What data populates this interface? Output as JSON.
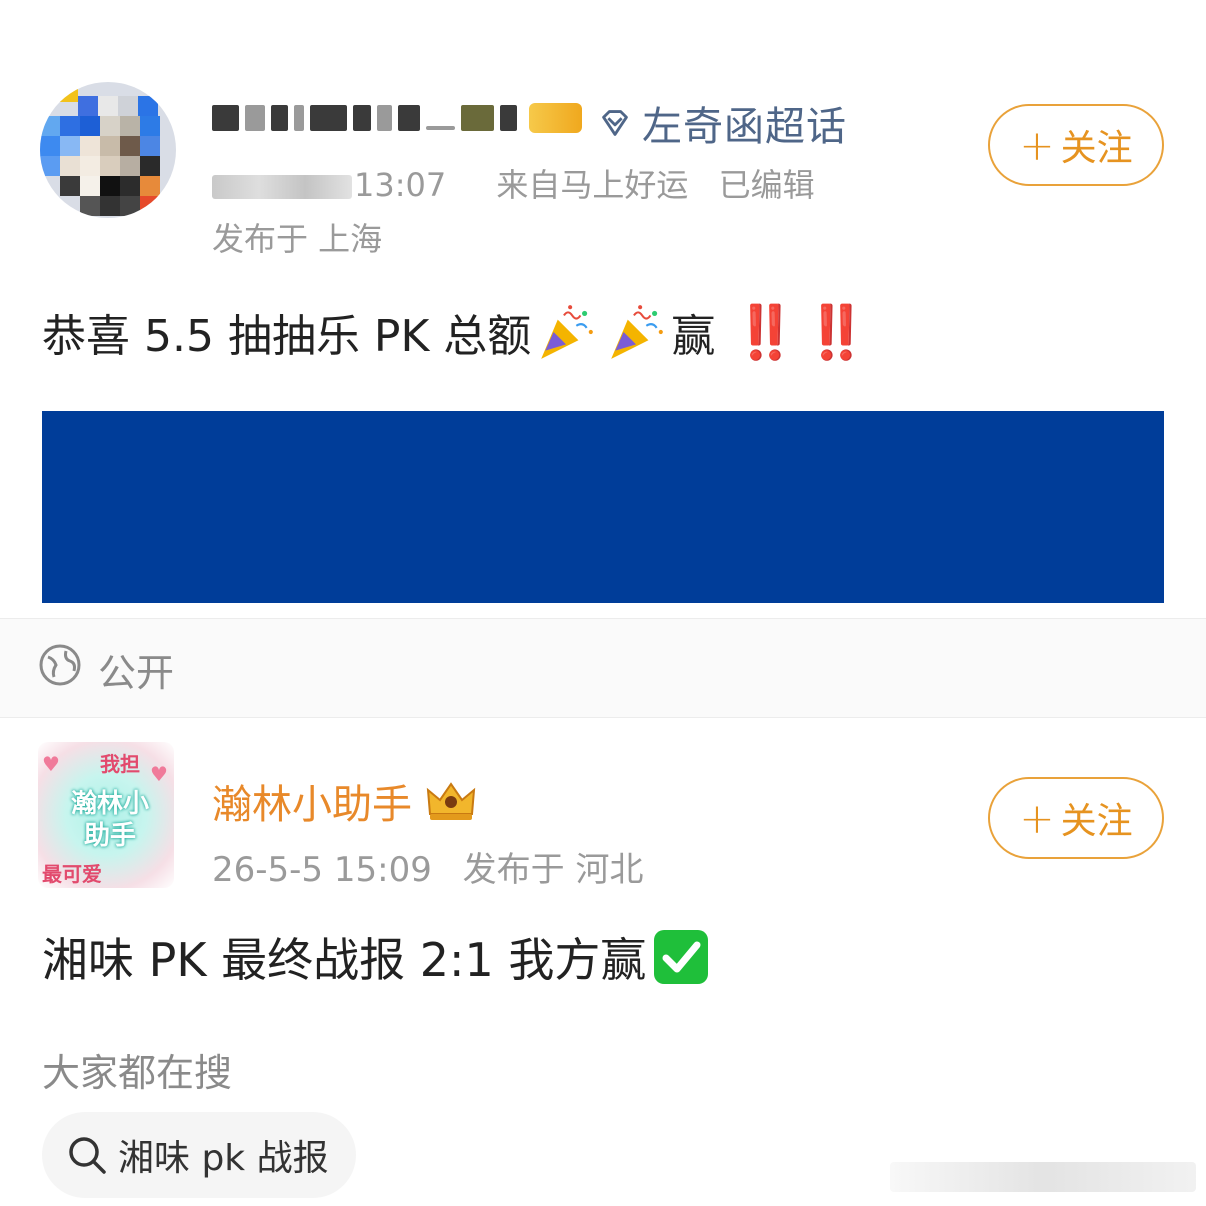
{
  "post1": {
    "topic_label": "左奇函超话",
    "meta": {
      "time_suffix": "13:07",
      "source": "来自马上好运",
      "edited": "已编辑"
    },
    "location": "发布于 上海",
    "follow_label": "关注",
    "content_text": "恭喜 5.5 抽抽乐 PK 总额",
    "content_after": "赢",
    "emphasis": "‼️ ‼️"
  },
  "visibility": {
    "label": "公开"
  },
  "post2": {
    "avatar_text": {
      "top": "我担",
      "mid": "瀚林小助手",
      "bottom": "最可爱"
    },
    "author": "瀚林小助手",
    "time": "26-5-5 15:09",
    "location": "发布于 河北",
    "follow_label": "关注",
    "content_text": "湘味 PK 最终战报 2:1 我方赢"
  },
  "search": {
    "heading": "大家都在搜",
    "chip_label": "湘味 pk 战报"
  },
  "colors": {
    "accent_orange": "#e69320",
    "topic_blue": "#4f6688",
    "image_block": "#003d99",
    "alert_red": "#e0141e"
  },
  "icons": [
    "diamond-icon",
    "party-popper-icon",
    "globe-icon",
    "crown-icon",
    "check-mark-icon",
    "search-icon"
  ]
}
